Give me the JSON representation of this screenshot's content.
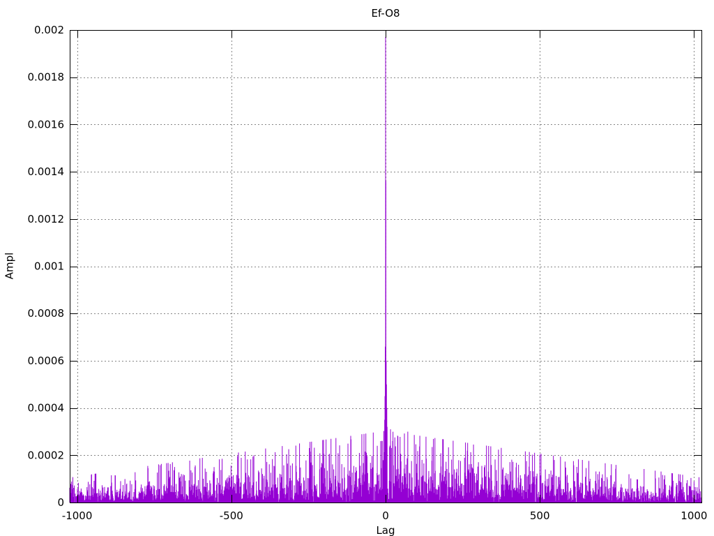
{
  "window": {
    "background": "#ffffff"
  },
  "chart_data": {
    "type": "impulses",
    "title": "Ef-O8",
    "xlabel": "Lag",
    "ylabel": "Ampl",
    "xlim": [
      -1024,
      1024
    ],
    "ylim": [
      0,
      0.002
    ],
    "xticks": [
      {
        "value": -1000,
        "label": "-1000"
      },
      {
        "value": -500,
        "label": "-500"
      },
      {
        "value": 0,
        "label": "0"
      },
      {
        "value": 500,
        "label": "500"
      },
      {
        "value": 1000,
        "label": "1000"
      }
    ],
    "yticks": [
      {
        "value": 0,
        "label": "0"
      },
      {
        "value": 0.0002,
        "label": "0.0002"
      },
      {
        "value": 0.0004,
        "label": "0.0004"
      },
      {
        "value": 0.0006,
        "label": "0.0006"
      },
      {
        "value": 0.0008,
        "label": "0.0008"
      },
      {
        "value": 0.001,
        "label": "0.001"
      },
      {
        "value": 0.0012,
        "label": "0.0012"
      },
      {
        "value": 0.0014,
        "label": "0.0014"
      },
      {
        "value": 0.0016,
        "label": "0.0016"
      },
      {
        "value": 0.0018,
        "label": "0.0018"
      },
      {
        "value": 0.002,
        "label": "0.002"
      }
    ],
    "grid": {
      "show": true,
      "color": "#858585",
      "dash": [
        2,
        3
      ]
    },
    "legend": "none",
    "colors": {
      "line": "#9400d3",
      "border": "#000000",
      "text": "#000000",
      "background": "#ffffff"
    },
    "series": [
      {
        "name": "Ef-O8",
        "style": "impulses",
        "peak_points": [
          [
            -27,
            0.00024
          ],
          [
            -16,
            0.00026
          ],
          [
            -3,
            0.00035
          ],
          [
            -2,
            0.00045
          ],
          [
            -1,
            0.00066
          ],
          [
            0,
            0.00197
          ],
          [
            1,
            0.00136
          ],
          [
            2,
            0.0006
          ],
          [
            3,
            0.0005
          ],
          [
            4,
            0.0004
          ],
          [
            5,
            0.00032
          ],
          [
            16,
            0.00031
          ],
          [
            23,
            0.00026
          ],
          [
            40,
            0.00028
          ],
          [
            72,
            0.0003
          ]
        ],
        "noise_model": {
          "seed": 20240817,
          "distribution": "exponential",
          "envelope_edge": 3.3e-05,
          "envelope_center": 9.5e-05,
          "clip_factor": 3.2
        }
      }
    ]
  }
}
